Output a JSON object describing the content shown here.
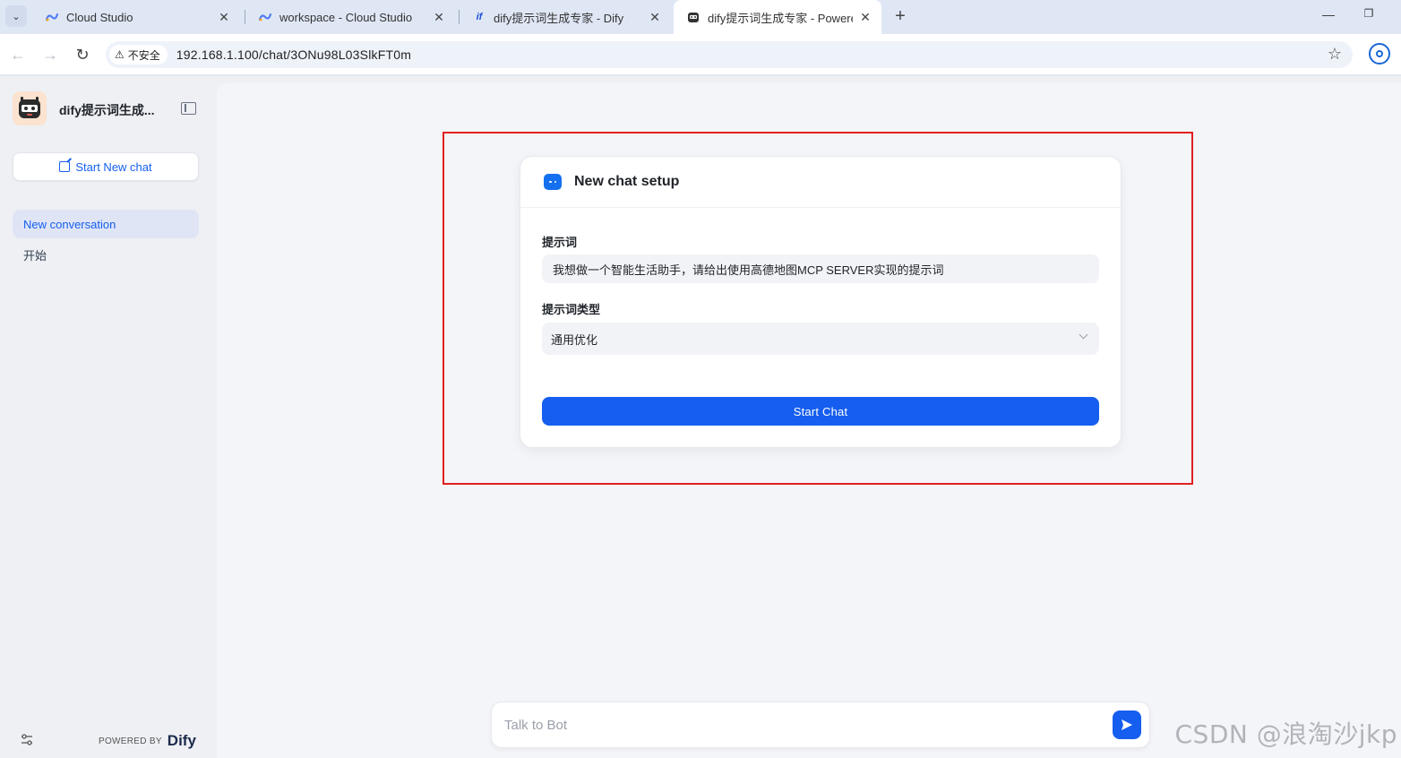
{
  "browser": {
    "tabs": [
      {
        "title": "Cloud Studio",
        "icon": "cloud-studio-icon",
        "active": false
      },
      {
        "title": "workspace - Cloud Studio",
        "icon": "cloud-studio-icon",
        "active": false
      },
      {
        "title": "dify提示词生成专家 - Dify",
        "icon": "dify-icon",
        "active": false
      },
      {
        "title": "dify提示词生成专家 - Powered",
        "icon": "robot-icon",
        "active": true
      }
    ],
    "security_label": "不安全",
    "url": "192.168.1.100/chat/3ONu98L03SlkFT0m"
  },
  "sidebar": {
    "app_name": "dify提示词生成...",
    "new_chat_label": "Start New chat",
    "conversations": [
      {
        "label": "New conversation",
        "active": true
      },
      {
        "label": "开始",
        "active": false
      }
    ],
    "powered_by": "POWERED BY",
    "brand": "Dify"
  },
  "setup": {
    "title": "New chat setup",
    "prompt_label": "提示词",
    "prompt_value": "我想做一个智能生活助手，请给出使用高德地图MCP SERVER实现的提示词",
    "type_label": "提示词类型",
    "type_value": "通用优化",
    "start_label": "Start Chat"
  },
  "chat": {
    "placeholder": "Talk to Bot"
  },
  "watermark": "CSDN @浪淘沙jkp",
  "colors": {
    "accent": "#155eef",
    "highlight_border": "#e02020",
    "sidebar_bg": "#eef0f4"
  }
}
